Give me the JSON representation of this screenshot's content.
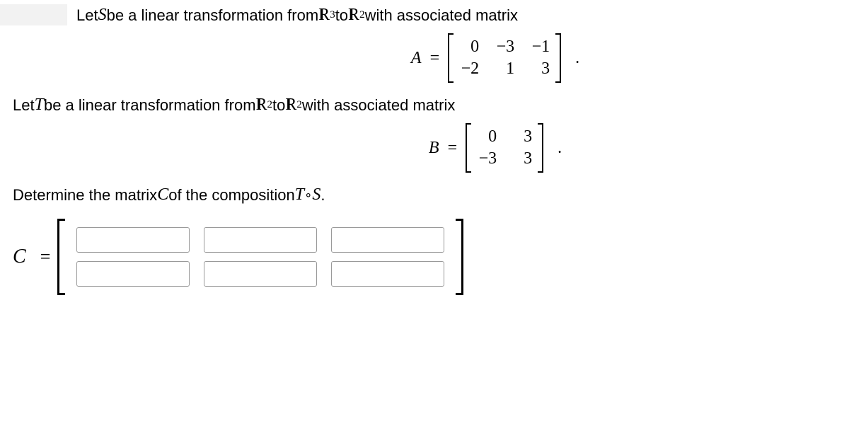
{
  "problem": {
    "line1_a": "Let ",
    "line1_var1": "S",
    "line1_b": " be a linear transformation from ",
    "line1_R1": "R",
    "line1_sup1": "3",
    "line1_c": " to ",
    "line1_R2": "R",
    "line1_sup2": "2",
    "line1_d": " with associated matrix",
    "matrixA": {
      "label": "A",
      "eq": "=",
      "rows": [
        [
          "0",
          "−3",
          "−1"
        ],
        [
          "−2",
          "1",
          "3"
        ]
      ],
      "period": "."
    },
    "line2_a": "Let ",
    "line2_var1": "T",
    "line2_b": " be a linear transformation from ",
    "line2_R1": "R",
    "line2_sup1": "2",
    "line2_c": " to ",
    "line2_R2": "R",
    "line2_sup2": "2",
    "line2_d": " with associated matrix",
    "matrixB": {
      "label": "B",
      "eq": "=",
      "rows": [
        [
          "0",
          "3"
        ],
        [
          "−3",
          "3"
        ]
      ],
      "period": "."
    },
    "line3_a": "Determine the matrix ",
    "line3_var1": "C",
    "line3_b": " of the composition ",
    "line3_var2": "T",
    "line3_compose": " ∘ ",
    "line3_var3": "S",
    "line3_c": ".",
    "answer": {
      "label": "C",
      "eq": "=",
      "inputs": [
        "",
        "",
        "",
        "",
        "",
        ""
      ]
    }
  }
}
